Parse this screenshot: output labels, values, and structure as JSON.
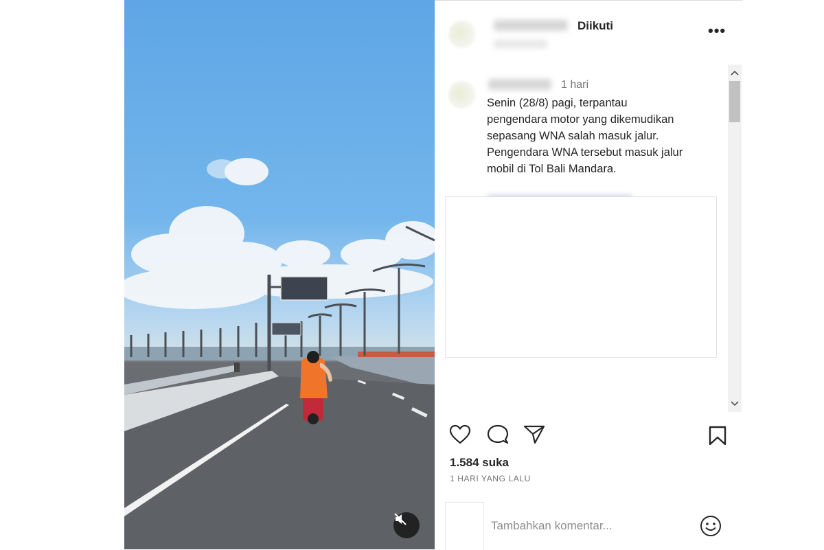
{
  "post": {
    "follow_status": "Diikuti",
    "more_icon": "more-horizontal-icon",
    "caption_time": "1 hari",
    "caption_lines": [
      "Senin (28/8) pagi, terpantau",
      "pengendara motor yang dikemudikan",
      "sepasang WNA salah masuk jalur.",
      "Pengendara WNA tersebut masuk jalur",
      "mobil di Tol Bali Mandara."
    ],
    "likes": "1.584 suka",
    "posted_ago": "1 HARI YANG LALU",
    "comment_placeholder": "Tambahkan komentar..."
  },
  "video": {
    "mute_icon": "speaker-muted-icon"
  },
  "colors": {
    "sky": "#6cb0ea",
    "road": "#5f6267",
    "rider": "#f0752a"
  }
}
